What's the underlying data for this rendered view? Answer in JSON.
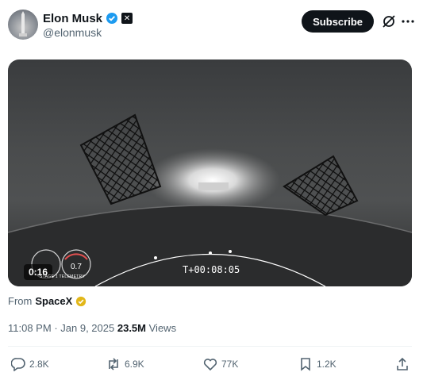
{
  "author": {
    "name": "Elon Musk",
    "handle": "@elonmusk"
  },
  "header": {
    "subscribe_label": "Subscribe"
  },
  "media": {
    "duration": "0:16",
    "mission_clock": "T+00:08:05",
    "telemetry_label": "STAGE 1 TELEMETRY",
    "altitude_value": "0.7"
  },
  "source": {
    "prefix": "From",
    "name": "SpaceX"
  },
  "meta": {
    "time": "11:08 PM",
    "separator": "·",
    "date": "Jan 9, 2025",
    "views_count": "23.5M",
    "views_label": "Views"
  },
  "actions": {
    "replies": "2.8K",
    "reposts": "6.9K",
    "likes": "77K",
    "bookmarks": "1.2K"
  },
  "colors": {
    "verified_blue": "#1d9bf0",
    "gold_badge": "#e2b719",
    "text_primary": "#0f1419",
    "text_secondary": "#536471"
  },
  "icons": [
    "verified-badge-icon",
    "x-affiliate-icon",
    "grok-icon",
    "more-icon",
    "gold-verified-icon",
    "reply-icon",
    "repost-icon",
    "like-icon",
    "bookmark-icon",
    "share-icon"
  ]
}
